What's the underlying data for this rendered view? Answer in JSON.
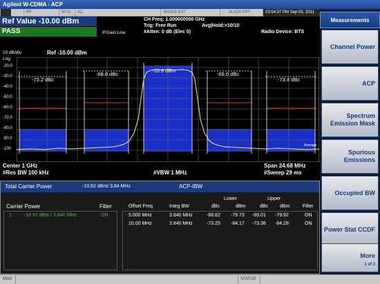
{
  "window": {
    "title": "Agilent W-CDMA - ACP"
  },
  "statusbar": {
    "rf": "RF",
    "impedance": "50 Ω",
    "ac": "AC",
    "sense": "SENSE:EXT",
    "align": "ALIGN OFF",
    "timestamp": "03:54:37 PM Sep 05, 2011"
  },
  "header": {
    "ref_value": "Ref Value  -10.00 dBm",
    "pass": "PASS",
    "ifgain": "IFGain:Low",
    "ch_freq": "CH Freq: 1.000000000 GHz",
    "trig": "Trig: Free Run",
    "avg_hold": "Avg|Hold:>10/10",
    "atten": "#Atten: 0 dB (Elec 0)",
    "radio_device": "Radio Device: BTS"
  },
  "graph": {
    "scale": "10 dB/div",
    "log": "Log",
    "ref": "Ref -10.00 dBm",
    "y_ticks": [
      "-20.0",
      "-30.0",
      "-40.0",
      "-50.0",
      "-60.0",
      "-70.0",
      "-80.0",
      "-90.0",
      "-100"
    ],
    "labels": {
      "lower2": "-73.2 dBc",
      "lower1": "-68.8 dBc",
      "carrier": "-10.9 dBm",
      "upper1": "-69.0 dBc",
      "upper2": "-73.4 dBc"
    },
    "average": "Average",
    "center": "Center  1 GHz",
    "res_bw": "#Res BW  100 kHz",
    "vbw": "#VBW  1 MHz",
    "span": "Span 24.68 MHz",
    "sweep": "#Sweep  29 ms",
    "colors": {
      "band": "#1a2fc8",
      "trace": "#f2f27a",
      "limit": "#d22020",
      "grid": "#7a7a7a"
    }
  },
  "results": {
    "total_carrier_power_label": "Total Carrier Power",
    "total_carrier_power_value": "-10.92 dBm/ 3.84 MHz",
    "mode": "ACP-IBW",
    "carrier_power_label": "Carrier Power",
    "filter_label": "Filter",
    "carrier_row": {
      "index": "1",
      "value": "-10.92 dBm /  3.840 MHz",
      "filter": "ON"
    },
    "columns": {
      "offset_freq": "Offset Freq",
      "integ_bw": "Integ BW",
      "lower": "Lower",
      "upper": "Upper",
      "dbc": "dBc",
      "dbm": "dBm",
      "filter": "Filter"
    },
    "rows": [
      {
        "offset": "5.000 MHz",
        "integ": "3.840 MHz",
        "lower_dbc": "-68.82",
        "lower_dbm": "-79.73",
        "upper_dbc": "-69.01",
        "upper_dbm": "-79.92",
        "filter": "ON"
      },
      {
        "offset": "10.00 MHz",
        "integ": "3.840 MHz",
        "lower_dbc": "-73.25",
        "lower_dbm": "-84.17",
        "upper_dbc": "-73.36",
        "upper_dbm": "-84.28",
        "filter": "ON"
      }
    ]
  },
  "softkeys": {
    "title": "Measurements",
    "items": [
      "Channel Power",
      "ACP",
      "Spectrum Emission Mask",
      "Spurious Emissions",
      "Occupied BW",
      "Power Stat CCDF",
      "More"
    ],
    "more_page": "1 of 3"
  },
  "bottombar": {
    "msg": "MSG",
    "status": "STATUS"
  }
}
